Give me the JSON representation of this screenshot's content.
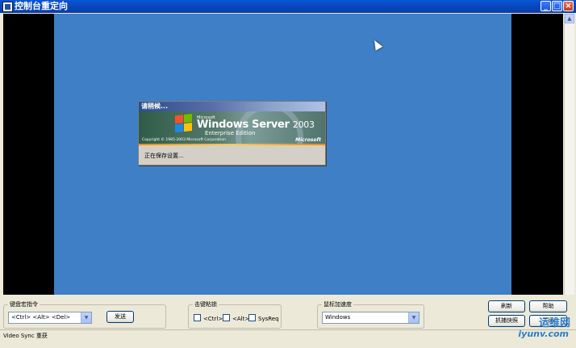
{
  "window": {
    "title": "控制台重定向",
    "buttons": {
      "minimize": "_",
      "maximize": "□",
      "close": "×"
    }
  },
  "remote_screen": {
    "dialog_title": "请稍候...",
    "microsoft_small": "Microsoft",
    "product_name": "Windows Server",
    "product_version": "2003",
    "edition": "Enterprise Edition",
    "copyright": "Copyright © 1985-2003  Microsoft Corporation",
    "brand": "Microsoft",
    "status_text": "正在保存设置..."
  },
  "controls": {
    "keyboard_macro": {
      "legend": "键盘宏指令",
      "selected": "<Ctrl> <Alt> <Del>",
      "send_label": "发送"
    },
    "sticky_keys": {
      "legend": "击键粘锁",
      "ctrl_label": "<Ctrl>",
      "alt_label": "<Alt>",
      "sysreq_label": "SysReq"
    },
    "mouse_accel": {
      "legend": "鼠标加速度",
      "selected": "Windows"
    },
    "refresh_label": "刷新",
    "help_label": "帮助",
    "screenshot_label": "抓捕快照",
    "close_label": "关闭"
  },
  "status": {
    "text": "Video Sync 重获"
  },
  "watermark": {
    "main": "运维网",
    "sub": "iyunv.com"
  }
}
